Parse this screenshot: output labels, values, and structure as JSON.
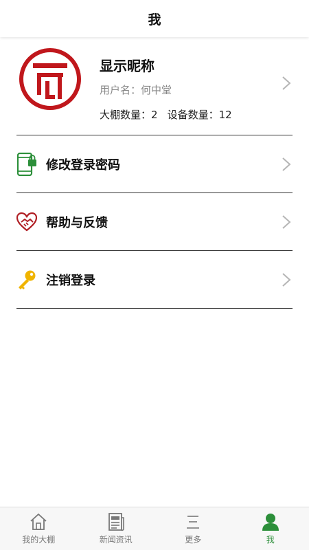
{
  "header": {
    "title": "我"
  },
  "profile": {
    "nickname": "显示昵称",
    "username_label": "用户名：",
    "username": "何中堂",
    "greenhouse_label": "大棚数量：",
    "greenhouse_count": "2",
    "device_label": "设备数量：",
    "device_count": "12"
  },
  "menu": [
    {
      "label": "修改登录密码",
      "icon": "phone-lock-icon"
    },
    {
      "label": "帮助与反馈",
      "icon": "handshake-heart-icon"
    },
    {
      "label": "注销登录",
      "icon": "key-icon"
    }
  ],
  "tabbar": [
    {
      "label": "我的大棚",
      "icon": "home-icon",
      "active": false
    },
    {
      "label": "新闻资讯",
      "icon": "news-icon",
      "active": false
    },
    {
      "label": "更多",
      "icon": "menu-lines-icon",
      "active": false
    },
    {
      "label": "我",
      "icon": "user-icon",
      "active": true
    }
  ],
  "colors": {
    "accent_green": "#2c8f3a",
    "logo_red": "#c0171c",
    "key_yellow": "#f0b400",
    "inactive_gray": "#777777"
  }
}
